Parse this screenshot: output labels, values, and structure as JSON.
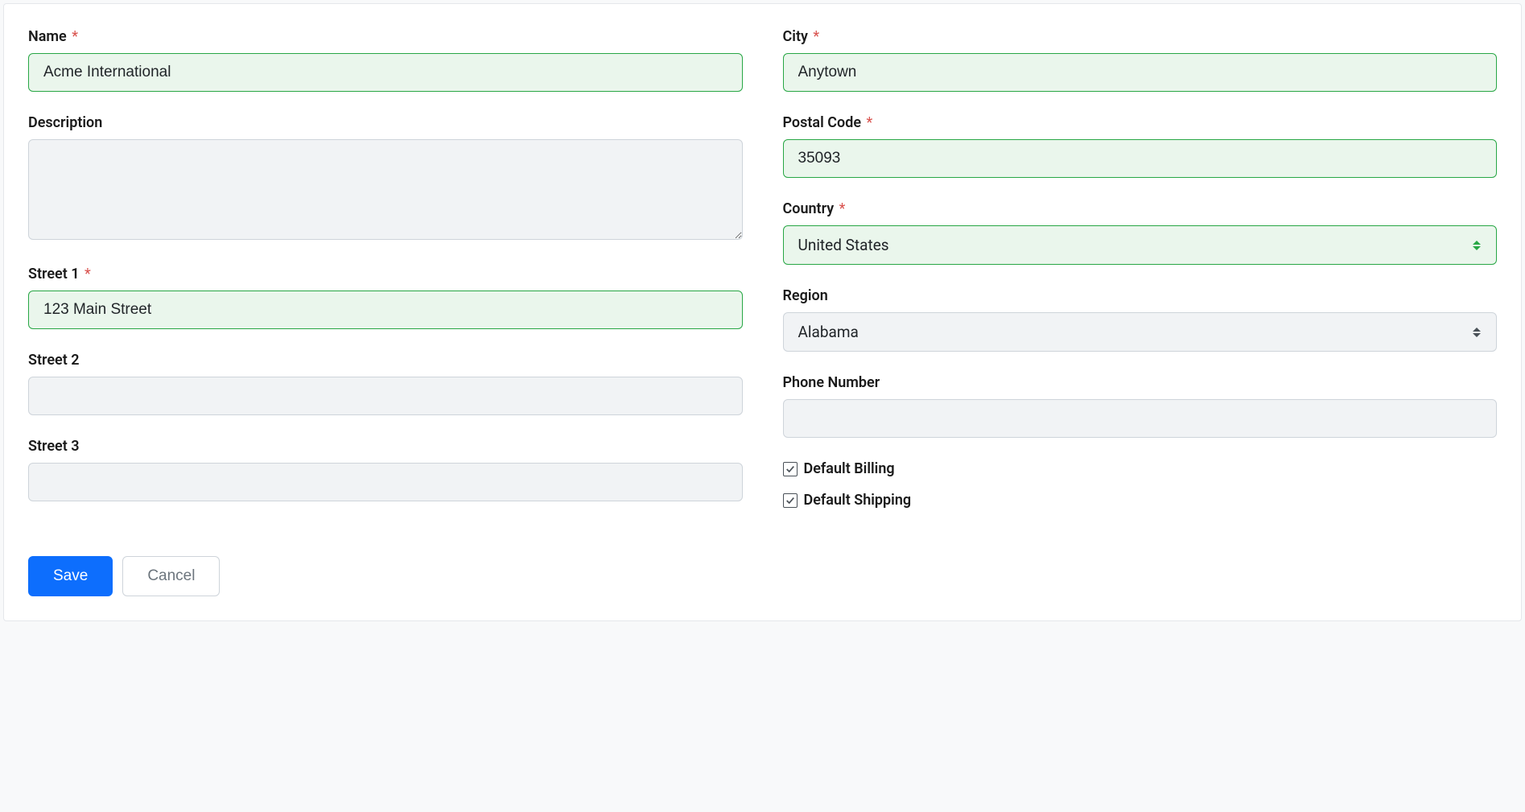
{
  "fields": {
    "name": {
      "label": "Name",
      "value": "Acme International",
      "required": true
    },
    "description": {
      "label": "Description",
      "value": "",
      "required": false
    },
    "street1": {
      "label": "Street 1",
      "value": "123 Main Street",
      "required": true
    },
    "street2": {
      "label": "Street 2",
      "value": "",
      "required": false
    },
    "street3": {
      "label": "Street 3",
      "value": "",
      "required": false
    },
    "city": {
      "label": "City",
      "value": "Anytown",
      "required": true
    },
    "postalCode": {
      "label": "Postal Code",
      "value": "35093",
      "required": true
    },
    "country": {
      "label": "Country",
      "value": "United States",
      "required": true
    },
    "region": {
      "label": "Region",
      "value": "Alabama",
      "required": false
    },
    "phone": {
      "label": "Phone Number",
      "value": "",
      "required": false
    }
  },
  "checkboxes": {
    "defaultBilling": {
      "label": "Default Billing",
      "checked": true
    },
    "defaultShipping": {
      "label": "Default Shipping",
      "checked": true
    }
  },
  "buttons": {
    "save": "Save",
    "cancel": "Cancel"
  }
}
